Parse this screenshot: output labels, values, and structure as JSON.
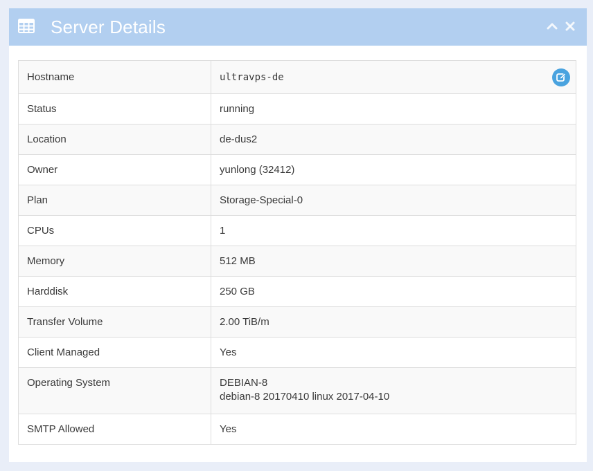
{
  "panel": {
    "title": "Server Details",
    "header_icon": "table-icon",
    "tools": [
      "chevron-up-icon",
      "close-icon"
    ]
  },
  "rows": [
    {
      "label": "Hostname",
      "value": "ultravps-de"
    },
    {
      "label": "Status",
      "value": "running"
    },
    {
      "label": "Location",
      "value": "de-dus2"
    },
    {
      "label": "Owner",
      "value": "yunlong (32412)"
    },
    {
      "label": "Plan",
      "value": "Storage-Special-0"
    },
    {
      "label": "CPUs",
      "value": "1"
    },
    {
      "label": "Memory",
      "value": "512 MB"
    },
    {
      "label": "Harddisk",
      "value": "250 GB"
    },
    {
      "label": "Transfer Volume",
      "value": "2.00 TiB/m"
    },
    {
      "label": "Client Managed",
      "value": "Yes"
    },
    {
      "label": "Operating System",
      "value": "DEBIAN-8",
      "value2": "debian-8 20170410 linux 2017-04-10"
    },
    {
      "label": "SMTP Allowed",
      "value": "Yes"
    }
  ],
  "colors": {
    "header_bg": "#b2cff0",
    "edit_button": "#4aa3df",
    "page_bg": "#e9eef8"
  }
}
